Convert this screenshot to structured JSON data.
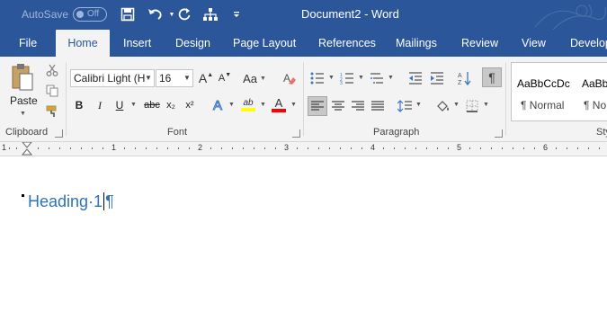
{
  "titlebar": {
    "autosave_label": "AutoSave",
    "autosave_state": "Off",
    "title": "Document2  -  Word",
    "qat": [
      {
        "name": "save-icon"
      },
      {
        "name": "undo-icon"
      },
      {
        "name": "redo-icon"
      },
      {
        "name": "touch-mode-icon"
      },
      {
        "name": "customize-qat-icon"
      }
    ]
  },
  "tabs": [
    {
      "label": "File",
      "active": false
    },
    {
      "label": "Home",
      "active": true
    },
    {
      "label": "Insert",
      "active": false
    },
    {
      "label": "Design",
      "active": false
    },
    {
      "label": "Page Layout",
      "active": false
    },
    {
      "label": "References",
      "active": false
    },
    {
      "label": "Mailings",
      "active": false
    },
    {
      "label": "Review",
      "active": false
    },
    {
      "label": "View",
      "active": false
    },
    {
      "label": "Develop",
      "active": false
    }
  ],
  "clipboard": {
    "paste_label": "Paste",
    "group_label": "Clipboard"
  },
  "font": {
    "font_name": "Calibri Light (H",
    "font_size": "16",
    "grow_label": "A",
    "shrink_label": "A",
    "case_label": "Aa",
    "bold": "B",
    "italic": "I",
    "underline": "U",
    "strike": "abc",
    "subscript": "x₂",
    "superscript": "x²",
    "effects": "A",
    "highlight": "ab",
    "font_color": "A",
    "group_label": "Font"
  },
  "paragraph": {
    "group_label": "Paragraph",
    "pilcrow": "¶"
  },
  "styles": {
    "items": [
      {
        "preview": "AaBbCcDc",
        "name": "¶ Normal"
      },
      {
        "preview": "AaBb",
        "name": "¶ No"
      }
    ],
    "group_label": "Sty"
  },
  "ruler": {
    "numbers": [
      "1",
      "1",
      "2",
      "3",
      "4",
      "5",
      "6"
    ]
  },
  "document": {
    "heading_text": "Heading·1",
    "pilcrow": "¶"
  },
  "colors": {
    "accent": "#2b579a",
    "ribbon_bg": "#f3f3f3",
    "heading": "#2e74b5",
    "highlight_yellow": "#ffff00",
    "font_red": "#ff0000"
  }
}
